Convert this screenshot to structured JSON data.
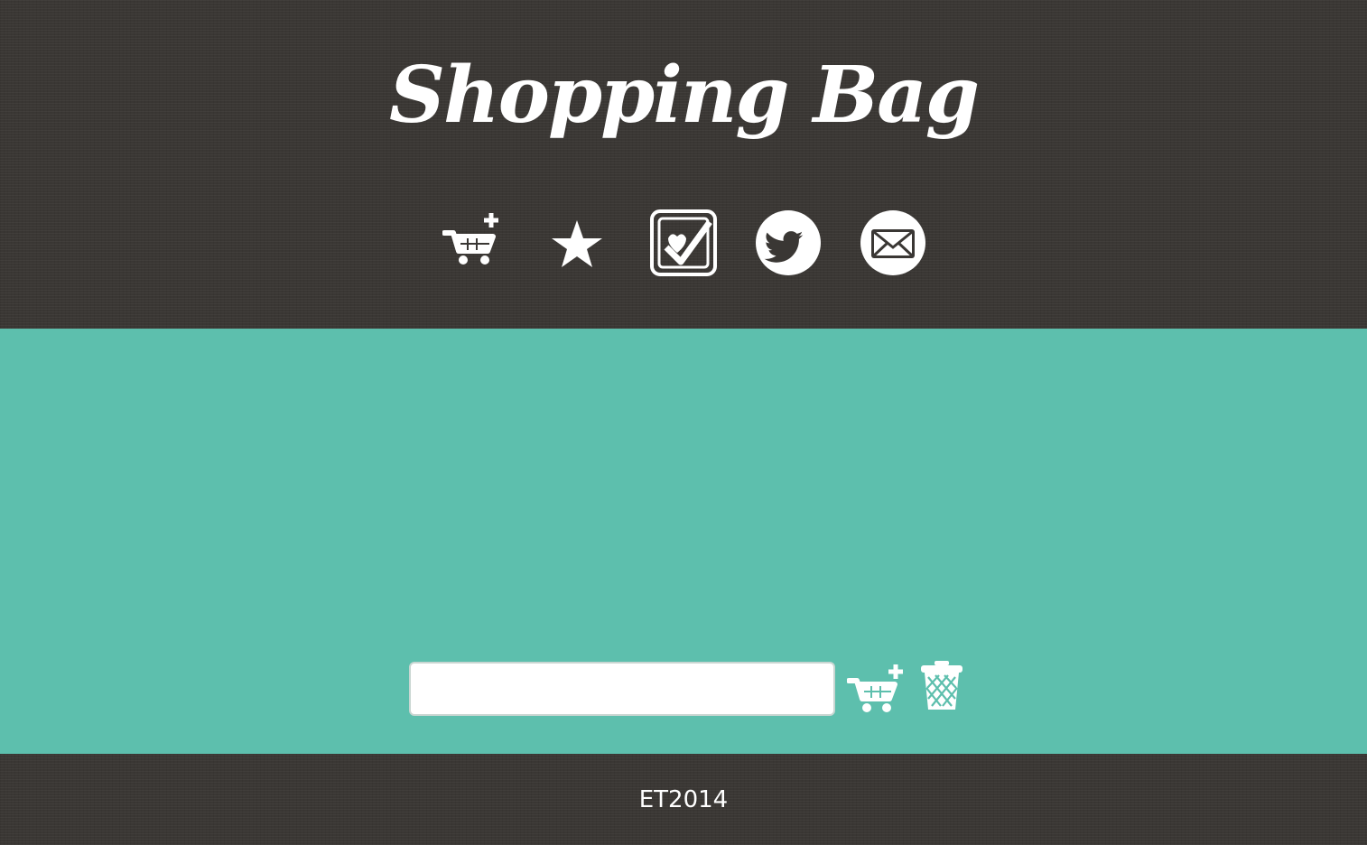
{
  "header": {
    "title": "Shopping Bag",
    "icons": [
      {
        "name": "cart-add-icon",
        "label": "Add to cart"
      },
      {
        "name": "star-icon",
        "label": "Favorites"
      },
      {
        "name": "checklist-icon",
        "label": "Checklist"
      },
      {
        "name": "twitter-icon",
        "label": "Twitter"
      },
      {
        "name": "mail-icon",
        "label": "Email"
      }
    ]
  },
  "main": {
    "input": {
      "value": "",
      "placeholder": ""
    },
    "actions": [
      {
        "name": "cart-add-icon",
        "label": "Add item"
      },
      {
        "name": "trash-icon",
        "label": "Clear list"
      }
    ]
  },
  "footer": {
    "copyright": "ET2014"
  },
  "colors": {
    "header_bg": "#3a3734",
    "main_bg": "#5dbfad",
    "icon": "#ffffff"
  }
}
